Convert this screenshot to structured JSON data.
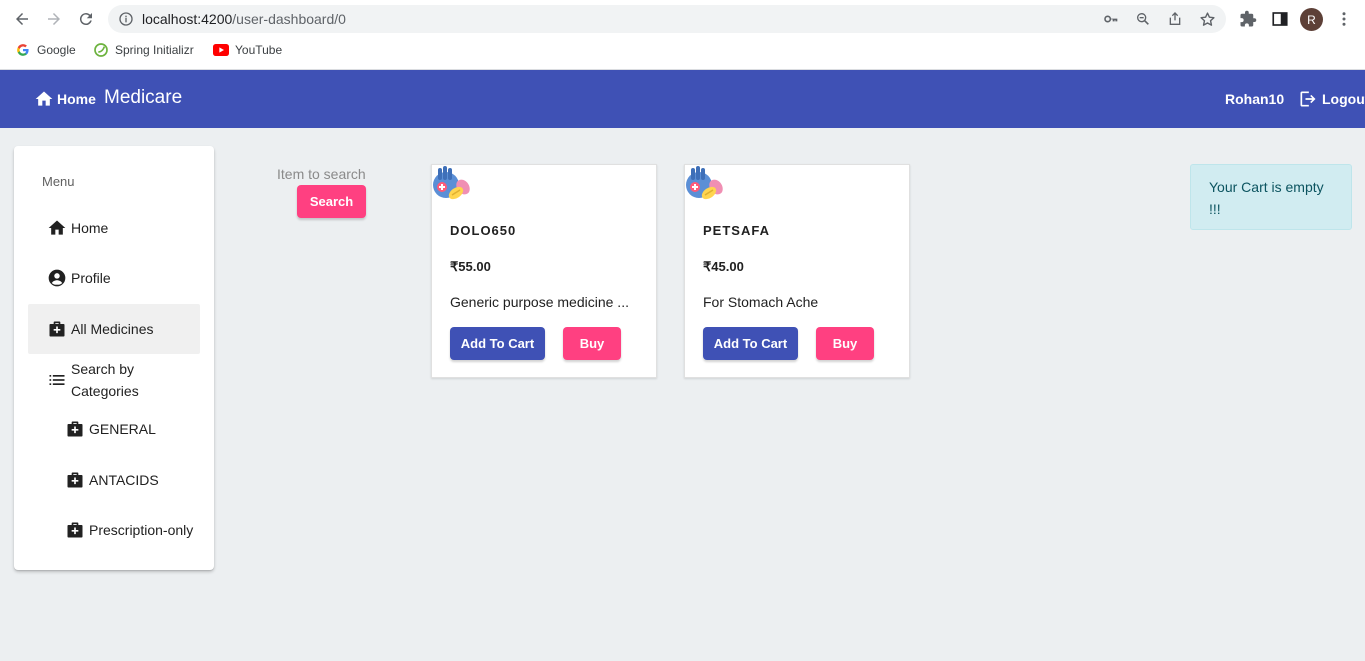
{
  "browser": {
    "url_host": "localhost:4200",
    "url_path": "/user-dashboard/0",
    "avatar_letter": "R",
    "bookmarks": [
      {
        "label": "Google",
        "icon": "google-icon"
      },
      {
        "label": "Spring Initializr",
        "icon": "spring-icon"
      },
      {
        "label": "YouTube",
        "icon": "youtube-icon"
      }
    ]
  },
  "header": {
    "home_label": "Home",
    "brand": "Medicare",
    "username": "Rohan10",
    "logout_label": "Logout",
    "color": "#3f51b5"
  },
  "sidebar": {
    "title": "Menu",
    "items": [
      {
        "label": "Home",
        "icon": "home-icon"
      },
      {
        "label": "Profile",
        "icon": "account-circle-icon"
      },
      {
        "label": "All Medicines",
        "icon": "medical-bag-icon",
        "active": true
      },
      {
        "label": "Search by Categories",
        "icon": "list-icon"
      }
    ],
    "categories": [
      {
        "label": "GENERAL",
        "icon": "medical-bag-icon"
      },
      {
        "label": "ANTACIDS",
        "icon": "medical-bag-icon"
      },
      {
        "label": "Prescription-only",
        "icon": "medical-bag-icon"
      }
    ]
  },
  "search": {
    "placeholder": "Item to search",
    "button_label": "Search"
  },
  "products": [
    {
      "name": "DOLO650",
      "price": "₹55.00",
      "description": "Generic purpose medicine ...",
      "add_label": "Add To Cart",
      "buy_label": "Buy",
      "icon": "pills-icon"
    },
    {
      "name": "PETSAFA",
      "price": "₹45.00",
      "description": "For Stomach Ache",
      "add_label": "Add To Cart",
      "buy_label": "Buy",
      "icon": "pills-icon"
    }
  ],
  "cart": {
    "message": "Your Cart is empty !!!"
  },
  "colors": {
    "primary": "#3f51b5",
    "accent": "#ff4081",
    "info_bg": "#d1ecf1"
  }
}
